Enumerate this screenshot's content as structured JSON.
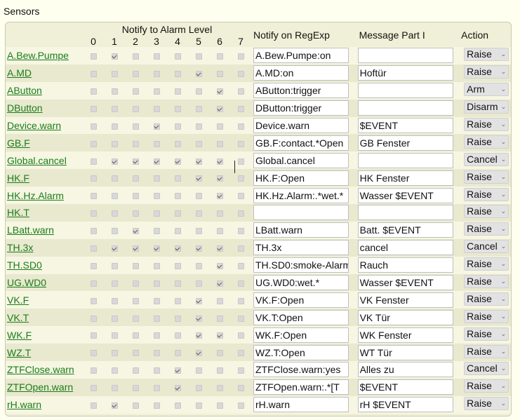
{
  "section_title": "Sensors",
  "headers": {
    "notify_level": "Notify to Alarm Level",
    "levels": [
      "0",
      "1",
      "2",
      "3",
      "4",
      "5",
      "6",
      "7"
    ],
    "regexp": "Notify on RegExp",
    "message": "Message Part I",
    "action": "Action"
  },
  "rows": [
    {
      "name": "A.Bew.Pumpe",
      "levels": [
        0,
        1,
        0,
        0,
        0,
        0,
        0,
        0
      ],
      "regexp": "A.Bew.Pumpe:on",
      "message": "",
      "action": "Raise"
    },
    {
      "name": "A.MD",
      "levels": [
        0,
        0,
        0,
        0,
        0,
        1,
        0,
        0
      ],
      "regexp": "A.MD:on",
      "message": "Hoftür",
      "action": "Raise"
    },
    {
      "name": "AButton",
      "levels": [
        0,
        0,
        0,
        0,
        0,
        0,
        1,
        0
      ],
      "regexp": "AButton:trigger",
      "message": "",
      "action": "Arm"
    },
    {
      "name": "DButton",
      "levels": [
        0,
        0,
        0,
        0,
        0,
        0,
        1,
        0
      ],
      "regexp": "DButton:trigger",
      "message": "",
      "action": "Disarm"
    },
    {
      "name": "Device.warn",
      "levels": [
        0,
        0,
        0,
        1,
        0,
        0,
        0,
        0
      ],
      "regexp": "Device.warn",
      "message": "$EVENT",
      "action": "Raise"
    },
    {
      "name": "GB.F",
      "levels": [
        0,
        0,
        0,
        0,
        0,
        0,
        0,
        0
      ],
      "regexp": "GB.F:contact.*Open",
      "message": "GB Fenster",
      "action": "Raise"
    },
    {
      "name": "Global.cancel",
      "levels": [
        0,
        1,
        1,
        1,
        1,
        1,
        1,
        0
      ],
      "regexp": "Global.cancel",
      "message": "",
      "action": "Cancel"
    },
    {
      "name": "HK.F",
      "levels": [
        0,
        0,
        0,
        0,
        0,
        1,
        1,
        0
      ],
      "regexp": "HK.F:Open",
      "message": "HK Fenster",
      "action": "Raise"
    },
    {
      "name": "HK.Hz.Alarm",
      "levels": [
        0,
        0,
        0,
        0,
        0,
        0,
        1,
        0
      ],
      "regexp": "HK.Hz.Alarm:.*wet.*",
      "message": "Wasser $EVENT",
      "action": "Raise"
    },
    {
      "name": "HK.T",
      "levels": [
        0,
        0,
        0,
        0,
        0,
        0,
        0,
        0
      ],
      "regexp": "",
      "message": "",
      "action": "Raise"
    },
    {
      "name": "LBatt.warn",
      "levels": [
        0,
        0,
        1,
        0,
        0,
        0,
        0,
        0
      ],
      "regexp": "LBatt.warn",
      "message": "Batt. $EVENT",
      "action": "Raise"
    },
    {
      "name": "TH.3x",
      "levels": [
        0,
        1,
        1,
        1,
        1,
        1,
        1,
        0
      ],
      "regexp": "TH.3x",
      "message": "cancel",
      "action": "Cancel"
    },
    {
      "name": "TH.SD0",
      "levels": [
        0,
        0,
        0,
        0,
        0,
        0,
        1,
        0
      ],
      "regexp": "TH.SD0:smoke-Alarm",
      "message": "Rauch",
      "action": "Raise"
    },
    {
      "name": "UG.WD0",
      "levels": [
        0,
        0,
        0,
        0,
        0,
        0,
        1,
        0
      ],
      "regexp": "UG.WD0:wet.*",
      "message": "Wasser $EVENT",
      "action": "Raise"
    },
    {
      "name": "VK.F",
      "levels": [
        0,
        0,
        0,
        0,
        0,
        1,
        0,
        0
      ],
      "regexp": "VK.F:Open",
      "message": "VK Fenster",
      "action": "Raise"
    },
    {
      "name": "VK.T",
      "levels": [
        0,
        0,
        0,
        0,
        0,
        1,
        0,
        0
      ],
      "regexp": "VK.T:Open",
      "message": "VK Tür",
      "action": "Raise"
    },
    {
      "name": "WK.F",
      "levels": [
        0,
        0,
        0,
        0,
        0,
        1,
        1,
        0
      ],
      "regexp": "WK.F:Open",
      "message": "WK Fenster",
      "action": "Raise"
    },
    {
      "name": "WZ.T",
      "levels": [
        0,
        0,
        0,
        0,
        0,
        1,
        0,
        0
      ],
      "regexp": "WZ.T:Open",
      "message": "WT Tür",
      "action": "Raise"
    },
    {
      "name": "ZTFClose.warn",
      "levels": [
        0,
        0,
        0,
        0,
        1,
        0,
        0,
        0
      ],
      "regexp": "ZTFClose.warn:yes",
      "message": "Alles zu",
      "action": "Cancel"
    },
    {
      "name": "ZTFOpen.warn",
      "levels": [
        0,
        0,
        0,
        0,
        1,
        0,
        0,
        0
      ],
      "regexp": "ZTFOpen.warn:.*[T",
      "message": "$EVENT",
      "action": "Raise"
    },
    {
      "name": "rH.warn",
      "levels": [
        0,
        1,
        0,
        0,
        0,
        0,
        0,
        0
      ],
      "regexp": "rH.warn",
      "message": "rH $EVENT",
      "action": "Raise"
    }
  ]
}
